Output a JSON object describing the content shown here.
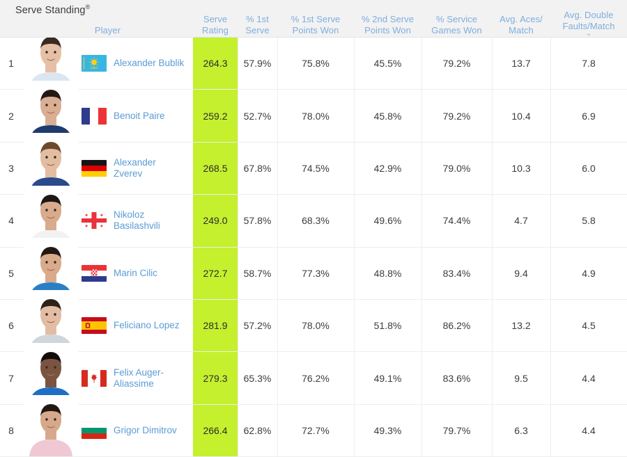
{
  "header": {
    "title": "Serve Standing",
    "title_mark": "®",
    "columns": [
      {
        "key": "rank",
        "label": "",
        "label2": "",
        "mark": "",
        "sorted": false
      },
      {
        "key": "player",
        "label": "Player",
        "label2": "",
        "mark": "",
        "sorted": false
      },
      {
        "key": "rating",
        "label": "Serve",
        "label2": "Rating",
        "mark": "®",
        "sorted": false
      },
      {
        "key": "first",
        "label": "% 1st",
        "label2": "Serve",
        "mark": "",
        "sorted": false
      },
      {
        "key": "fspw",
        "label": "% 1st Serve",
        "label2": "Points Won",
        "mark": "",
        "sorted": false
      },
      {
        "key": "sspw",
        "label": "% 2nd Serve",
        "label2": "Points Won",
        "mark": "",
        "sorted": false
      },
      {
        "key": "sgw",
        "label": "% Service",
        "label2": "Games Won",
        "mark": "",
        "sorted": false
      },
      {
        "key": "aces",
        "label": "Avg. Aces/",
        "label2": "Match",
        "mark": "",
        "sorted": false
      },
      {
        "key": "df",
        "label": "Avg. Double",
        "label2": "Faults/Match",
        "mark": "",
        "sorted": true
      }
    ],
    "sort_indicator": "⌄"
  },
  "colors": {
    "accent_link": "#5b9bd5",
    "header_text": "#7eaede",
    "highlight": "#c4f02e",
    "header_bg": "#f2f2f2",
    "grid": "#ededed",
    "text": "#3c3c3c"
  },
  "rows": [
    {
      "rank": "1",
      "name": "Alexander Bublik",
      "country": "kazakhstan",
      "rating": "264.3",
      "first": "57.9%",
      "fspw": "75.8%",
      "sspw": "45.5%",
      "sgw": "79.2%",
      "aces": "13.7",
      "df": "7.8"
    },
    {
      "rank": "2",
      "name": "Benoit Paire",
      "country": "france",
      "rating": "259.2",
      "first": "52.7%",
      "fspw": "78.0%",
      "sspw": "45.8%",
      "sgw": "79.2%",
      "aces": "10.4",
      "df": "6.9"
    },
    {
      "rank": "3",
      "name": "Alexander Zverev",
      "country": "germany",
      "rating": "268.5",
      "first": "67.8%",
      "fspw": "74.5%",
      "sspw": "42.9%",
      "sgw": "79.0%",
      "aces": "10.3",
      "df": "6.0"
    },
    {
      "rank": "4",
      "name": "Nikoloz Basilashvili",
      "country": "georgia",
      "rating": "249.0",
      "first": "57.8%",
      "fspw": "68.3%",
      "sspw": "49.6%",
      "sgw": "74.4%",
      "aces": "4.7",
      "df": "5.8"
    },
    {
      "rank": "5",
      "name": "Marin Cilic",
      "country": "croatia",
      "rating": "272.7",
      "first": "58.7%",
      "fspw": "77.3%",
      "sspw": "48.8%",
      "sgw": "83.4%",
      "aces": "9.4",
      "df": "4.9"
    },
    {
      "rank": "6",
      "name": "Feliciano Lopez",
      "country": "spain",
      "rating": "281.9",
      "first": "57.2%",
      "fspw": "78.0%",
      "sspw": "51.8%",
      "sgw": "86.2%",
      "aces": "13.2",
      "df": "4.5"
    },
    {
      "rank": "7",
      "name": "Felix Auger-Aliassime",
      "country": "canada",
      "rating": "279.3",
      "first": "65.3%",
      "fspw": "76.2%",
      "sspw": "49.1%",
      "sgw": "83.6%",
      "aces": "9.5",
      "df": "4.4"
    },
    {
      "rank": "8",
      "name": "Grigor Dimitrov",
      "country": "bulgaria",
      "rating": "266.4",
      "first": "62.8%",
      "fspw": "72.7%",
      "sspw": "49.3%",
      "sgw": "79.7%",
      "aces": "6.3",
      "df": "4.4"
    }
  ]
}
